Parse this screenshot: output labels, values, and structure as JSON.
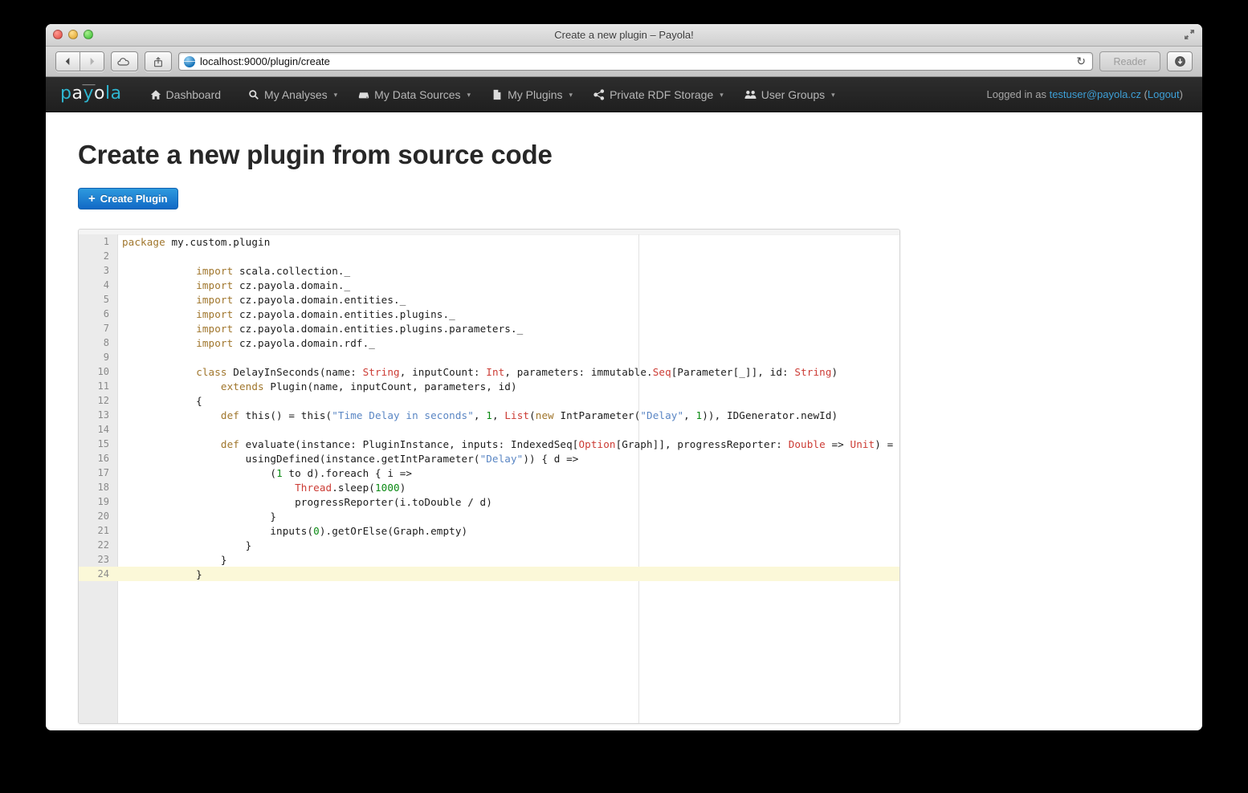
{
  "window": {
    "title": "Create a new plugin – Payola!",
    "traffic_lights": [
      "close",
      "minimize",
      "zoom"
    ],
    "fullscreen_icon": "fullscreen-icon"
  },
  "toolbar": {
    "back_icon": "back-arrow-icon",
    "forward_icon": "forward-arrow-icon",
    "icloud_icon": "icloud-tabs-icon",
    "share_icon": "share-icon",
    "url_host": "localhost:9000",
    "url_path": "/plugin/create",
    "reload_icon": "reload-icon",
    "reader_label": "Reader",
    "downloads_icon": "downloads-icon"
  },
  "navbar": {
    "brand": "payola",
    "brand_cyan_1": "p",
    "brand_white_1": "a",
    "brand_cyan_2": "y",
    "brand_white_2": "o",
    "brand_cyan_3": "la",
    "items": [
      {
        "label": "Dashboard",
        "icon": "home-icon",
        "caret": ""
      },
      {
        "label": "My Analyses",
        "icon": "search-icon",
        "caret": "▾"
      },
      {
        "label": "My Data Sources",
        "icon": "harddrive-icon",
        "caret": "▾"
      },
      {
        "label": "My Plugins",
        "icon": "file-icon",
        "caret": "▾"
      },
      {
        "label": "Private RDF Storage",
        "icon": "share-nodes-icon",
        "caret": "▾"
      },
      {
        "label": "User Groups",
        "icon": "users-icon",
        "caret": "▾"
      }
    ],
    "logged_in_prefix": "Logged in as ",
    "user_email": "testuser@payola.cz",
    "paren_open": " (",
    "logout_label": "Logout",
    "paren_close": ")"
  },
  "main": {
    "page_title": "Create a new plugin from source code",
    "create_button_icon": "plus-icon",
    "create_button_label": "Create Plugin"
  },
  "editor": {
    "active_line": 24,
    "total_lines": 24,
    "colors": {
      "keyword": "#a0762c",
      "string": "#5a86c4",
      "number": "#0a8a13",
      "type": "#cc3b34",
      "active_line_bg": "#fbf8d8",
      "gutter_bg": "#ebebeb",
      "line_number": "#8a8a8a"
    },
    "lines": [
      {
        "n": 1,
        "tokens": [
          {
            "t": "package",
            "c": "kw"
          },
          {
            "t": " my.custom.plugin",
            "c": ""
          }
        ]
      },
      {
        "n": 2,
        "tokens": []
      },
      {
        "n": 3,
        "tokens": [
          {
            "t": "            ",
            "c": ""
          },
          {
            "t": "import",
            "c": "kw"
          },
          {
            "t": " scala.collection._",
            "c": ""
          }
        ]
      },
      {
        "n": 4,
        "tokens": [
          {
            "t": "            ",
            "c": ""
          },
          {
            "t": "import",
            "c": "kw"
          },
          {
            "t": " cz.payola.domain._",
            "c": ""
          }
        ]
      },
      {
        "n": 5,
        "tokens": [
          {
            "t": "            ",
            "c": ""
          },
          {
            "t": "import",
            "c": "kw"
          },
          {
            "t": " cz.payola.domain.entities._",
            "c": ""
          }
        ]
      },
      {
        "n": 6,
        "tokens": [
          {
            "t": "            ",
            "c": ""
          },
          {
            "t": "import",
            "c": "kw"
          },
          {
            "t": " cz.payola.domain.entities.plugins._",
            "c": ""
          }
        ]
      },
      {
        "n": 7,
        "tokens": [
          {
            "t": "            ",
            "c": ""
          },
          {
            "t": "import",
            "c": "kw"
          },
          {
            "t": " cz.payola.domain.entities.plugins.parameters._",
            "c": ""
          }
        ]
      },
      {
        "n": 8,
        "tokens": [
          {
            "t": "            ",
            "c": ""
          },
          {
            "t": "import",
            "c": "kw"
          },
          {
            "t": " cz.payola.domain.rdf._",
            "c": ""
          }
        ]
      },
      {
        "n": 9,
        "tokens": []
      },
      {
        "n": 10,
        "tokens": [
          {
            "t": "            ",
            "c": ""
          },
          {
            "t": "class",
            "c": "kw"
          },
          {
            "t": " DelayInSeconds(name: ",
            "c": ""
          },
          {
            "t": "String",
            "c": "typ"
          },
          {
            "t": ", inputCount: ",
            "c": ""
          },
          {
            "t": "Int",
            "c": "typ"
          },
          {
            "t": ", parameters: immutable.",
            "c": ""
          },
          {
            "t": "Seq",
            "c": "typ"
          },
          {
            "t": "[Parameter[_]], id: ",
            "c": ""
          },
          {
            "t": "String",
            "c": "typ"
          },
          {
            "t": ")",
            "c": ""
          }
        ]
      },
      {
        "n": 11,
        "tokens": [
          {
            "t": "                ",
            "c": ""
          },
          {
            "t": "extends",
            "c": "kw"
          },
          {
            "t": " Plugin(name, inputCount, parameters, id)",
            "c": ""
          }
        ]
      },
      {
        "n": 12,
        "tokens": [
          {
            "t": "            {",
            "c": ""
          }
        ]
      },
      {
        "n": 13,
        "tokens": [
          {
            "t": "                ",
            "c": ""
          },
          {
            "t": "def",
            "c": "kw"
          },
          {
            "t": " this() = this(",
            "c": ""
          },
          {
            "t": "\"Time Delay in seconds\"",
            "c": "str"
          },
          {
            "t": ", ",
            "c": ""
          },
          {
            "t": "1",
            "c": "num"
          },
          {
            "t": ", ",
            "c": ""
          },
          {
            "t": "List",
            "c": "typ"
          },
          {
            "t": "(",
            "c": ""
          },
          {
            "t": "new",
            "c": "kw"
          },
          {
            "t": " IntParameter(",
            "c": ""
          },
          {
            "t": "\"Delay\"",
            "c": "str"
          },
          {
            "t": ", ",
            "c": ""
          },
          {
            "t": "1",
            "c": "num"
          },
          {
            "t": ")), IDGenerator.newId",
            "c": ""
          },
          {
            "t": ")",
            "c": ""
          }
        ]
      },
      {
        "n": 14,
        "tokens": []
      },
      {
        "n": 15,
        "tokens": [
          {
            "t": "                ",
            "c": ""
          },
          {
            "t": "def",
            "c": "kw"
          },
          {
            "t": " evaluate(instance: PluginInstance, inputs: IndexedSeq[",
            "c": ""
          },
          {
            "t": "Option",
            "c": "typ"
          },
          {
            "t": "[Graph]], progressReporter: ",
            "c": ""
          },
          {
            "t": "Double",
            "c": "typ"
          },
          {
            "t": " => ",
            "c": ""
          },
          {
            "t": "Unit",
            "c": "typ"
          },
          {
            "t": ") = {",
            "c": ""
          }
        ]
      },
      {
        "n": 16,
        "tokens": [
          {
            "t": "                    usingDefined(instance.getIntParameter(",
            "c": ""
          },
          {
            "t": "\"Delay\"",
            "c": "str"
          },
          {
            "t": ")) { d =>",
            "c": ""
          }
        ]
      },
      {
        "n": 17,
        "tokens": [
          {
            "t": "                        (",
            "c": ""
          },
          {
            "t": "1",
            "c": "num"
          },
          {
            "t": " to d).foreach { i =>",
            "c": ""
          }
        ]
      },
      {
        "n": 18,
        "tokens": [
          {
            "t": "                            ",
            "c": ""
          },
          {
            "t": "Thread",
            "c": "typ"
          },
          {
            "t": ".sleep(",
            "c": ""
          },
          {
            "t": "1000",
            "c": "num"
          },
          {
            "t": ")",
            "c": ""
          }
        ]
      },
      {
        "n": 19,
        "tokens": [
          {
            "t": "                            progressReporter(i.toDouble / d)",
            "c": ""
          }
        ]
      },
      {
        "n": 20,
        "tokens": [
          {
            "t": "                        }",
            "c": ""
          }
        ]
      },
      {
        "n": 21,
        "tokens": [
          {
            "t": "                        inputs(",
            "c": ""
          },
          {
            "t": "0",
            "c": "num"
          },
          {
            "t": ").getOrElse(Graph.empty)",
            "c": ""
          }
        ]
      },
      {
        "n": 22,
        "tokens": [
          {
            "t": "                    }",
            "c": ""
          }
        ]
      },
      {
        "n": 23,
        "tokens": [
          {
            "t": "                }",
            "c": ""
          }
        ]
      },
      {
        "n": 24,
        "tokens": [
          {
            "t": "            }",
            "c": ""
          }
        ]
      }
    ]
  }
}
